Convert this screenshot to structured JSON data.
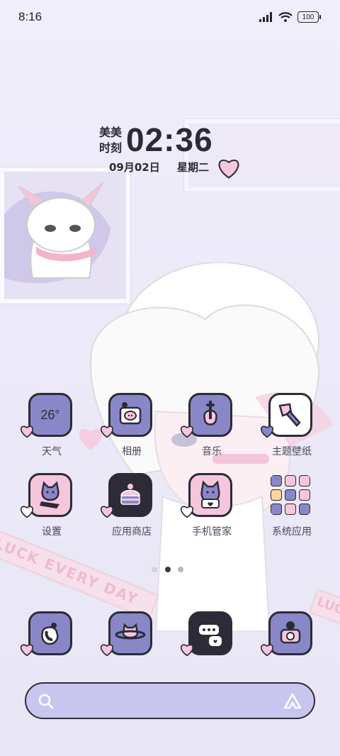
{
  "status_bar": {
    "time": "8:16",
    "battery": "100",
    "icons": [
      "signal-icon",
      "wifi-icon",
      "battery-icon"
    ]
  },
  "clock_widget": {
    "name": "美美\n时刻",
    "time": "02:36",
    "date": "09月02日",
    "weekday": "星期二"
  },
  "weather_widget": {
    "temperature": "26°"
  },
  "apps_row1": [
    {
      "label": "天气",
      "icon": "weather-icon"
    },
    {
      "label": "相册",
      "icon": "gallery-icon"
    },
    {
      "label": "音乐",
      "icon": "music-icon"
    },
    {
      "label": "主题壁纸",
      "icon": "theme-brush-icon"
    }
  ],
  "apps_row2": [
    {
      "label": "设置",
      "icon": "settings-cat-icon"
    },
    {
      "label": "应用商店",
      "icon": "app-store-cake-icon"
    },
    {
      "label": "手机管家",
      "icon": "phone-manager-icon"
    },
    {
      "label": "系统应用",
      "icon": "system-apps-folder-icon"
    }
  ],
  "page_indicator": {
    "pages": 2,
    "current": 1
  },
  "dock": [
    {
      "icon": "phone-icon"
    },
    {
      "icon": "browser-icon"
    },
    {
      "icon": "messages-icon"
    },
    {
      "icon": "camera-icon"
    }
  ],
  "wallpaper": {
    "banner_text": "LUCK EVERY DAY",
    "banner_text_right": "LUCK"
  },
  "colors": {
    "icon_purple": "#8a87c9",
    "icon_pink": "#f6c6dc",
    "icon_dark": "#2d2b38",
    "search_bg": "#c8c6ef"
  }
}
